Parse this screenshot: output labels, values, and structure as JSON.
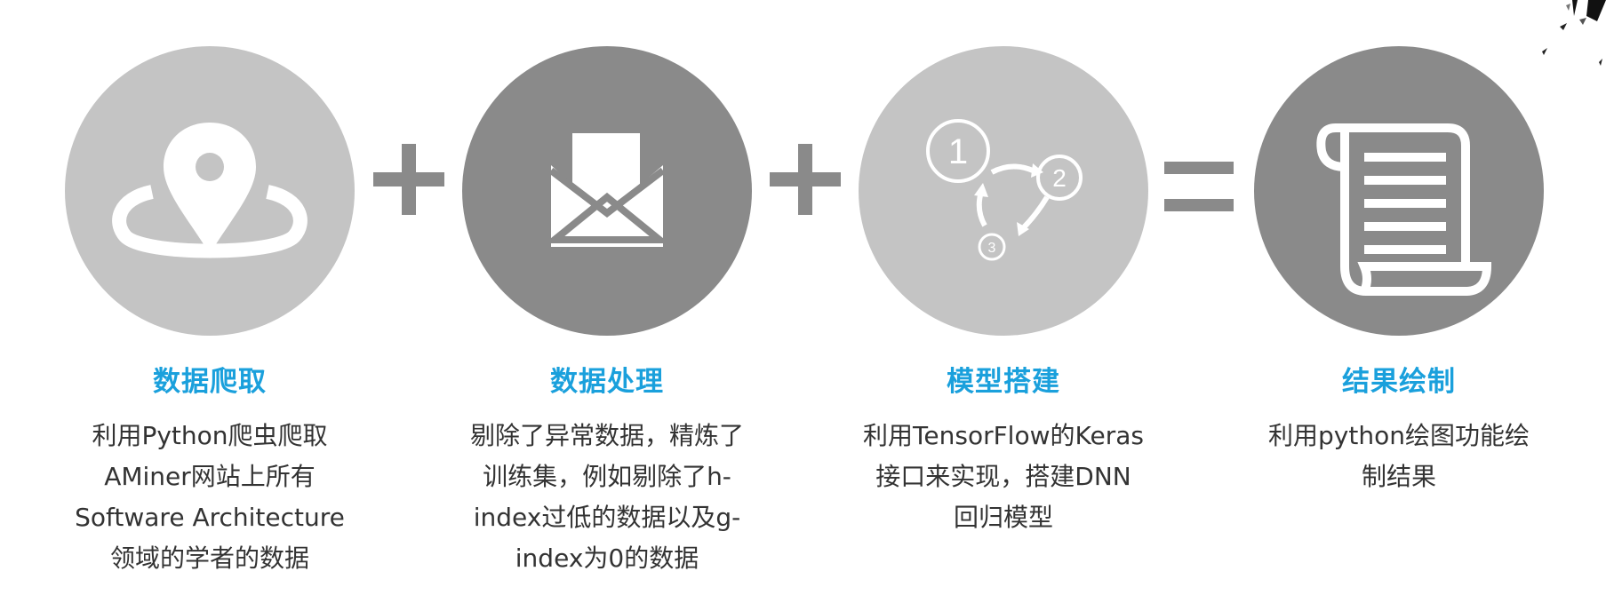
{
  "steps": [
    {
      "title": "数据爬取",
      "icon": "map-pin-icon",
      "desc_lines": [
        "利用Python爬虫爬取",
        "AMiner网站上所有",
        "Software Architecture",
        "领域的学者的数据"
      ]
    },
    {
      "title": "数据处理",
      "icon": "open-envelope-document-icon",
      "desc_lines": [
        "剔除了异常数据，精炼了",
        "训练集，例如剔除了h-",
        "index过低的数据以及g-",
        "index为0的数据"
      ]
    },
    {
      "title": "模型搭建",
      "icon": "numbered-cycle-icon",
      "icon_numbers": [
        "1",
        "2",
        "3"
      ],
      "desc_lines": [
        "利用TensorFlow的Keras",
        "接口来实现，搭建DNN",
        "回归模型"
      ]
    },
    {
      "title": "结果绘制",
      "icon": "scroll-icon",
      "desc_lines": [
        "利用python绘图功能绘",
        "制结果"
      ]
    }
  ],
  "operators": [
    "plus-icon",
    "plus-icon",
    "equals-icon"
  ],
  "colors": {
    "title": "#1aa0dc",
    "text": "#333333",
    "circle_light": "#c4c4c4",
    "circle_dark": "#8a8a8a",
    "operator": "#8a8a8a"
  }
}
